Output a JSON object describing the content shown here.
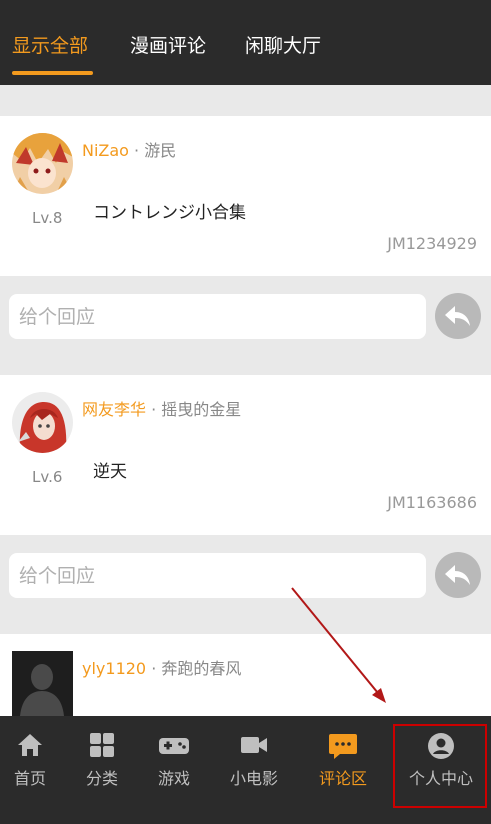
{
  "header": {
    "tabs": [
      {
        "label": "显示全部",
        "active": true
      },
      {
        "label": "漫画评论",
        "active": false
      },
      {
        "label": "闲聊大厅",
        "active": false
      }
    ]
  },
  "comments": [
    {
      "username": "NiZao",
      "separator": " · ",
      "title": "游民",
      "level": "Lv.8",
      "content": "コントレンジ小合集",
      "code": "JM1234929",
      "avatar": "anime-girl-avatar"
    },
    {
      "username": "网友李华",
      "separator": " · ",
      "title": "摇曳的金星",
      "level": "Lv.6",
      "content": "逆天",
      "code": "JM1163686",
      "avatar": "red-hair-avatar"
    },
    {
      "username": "yly1120",
      "separator": " · ",
      "title": "奔跑的春风",
      "avatar": "default-silhouette-avatar"
    }
  ],
  "reply": {
    "placeholder": "给个回应",
    "button_icon": "reply-arrow-icon"
  },
  "bottom_nav": [
    {
      "label": "首页",
      "icon": "home-icon",
      "active": false
    },
    {
      "label": "分类",
      "icon": "grid-icon",
      "active": false
    },
    {
      "label": "游戏",
      "icon": "gamepad-icon",
      "active": false
    },
    {
      "label": "小电影",
      "icon": "video-camera-icon",
      "active": false
    },
    {
      "label": "评论区",
      "icon": "chat-bubble-icon",
      "active": true
    },
    {
      "label": "个人中心",
      "icon": "user-circle-icon",
      "active": false
    }
  ],
  "colors": {
    "accent": "#f39a1e",
    "bar": "#2b2b2b",
    "background": "#e9e9e9",
    "annotation": "#cc0000"
  }
}
